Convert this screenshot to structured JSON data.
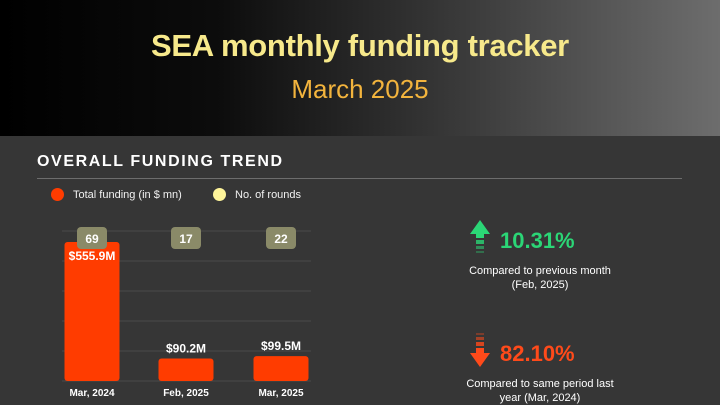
{
  "header": {
    "title": "SEA monthly funding tracker",
    "subtitle": "March 2025"
  },
  "section": {
    "title": "OVERALL FUNDING TREND"
  },
  "legend": [
    {
      "label": "Total funding (in $ mn)",
      "color": "#ff3c00"
    },
    {
      "label": "No. of rounds",
      "color": "#fff59a"
    }
  ],
  "chart_data": {
    "type": "bar",
    "categories": [
      "Mar, 2024",
      "Feb, 2025",
      "Mar, 2025"
    ],
    "series": [
      {
        "name": "Total funding (in $ mn)",
        "values": [
          555.9,
          90.2,
          99.5
        ],
        "labels": [
          "$555.9M",
          "$90.2M",
          "$99.5M"
        ],
        "color": "#ff3c00"
      },
      {
        "name": "No. of rounds",
        "values": [
          69,
          17,
          22
        ],
        "color": "#fff59a"
      }
    ],
    "ylim": [
      0,
      600
    ],
    "grid": true,
    "legend_position": "top-left"
  },
  "kpis": [
    {
      "value": "10.31%",
      "caption_line1": "Compared to previous month",
      "caption_line2": "(Feb, 2025)",
      "direction": "up",
      "color": "#2bd676"
    },
    {
      "value": "82.10%",
      "caption_line1": "Compared to same period last",
      "caption_line2": "year (Mar, 2024)",
      "direction": "down",
      "color": "#ff4a1a"
    }
  ]
}
